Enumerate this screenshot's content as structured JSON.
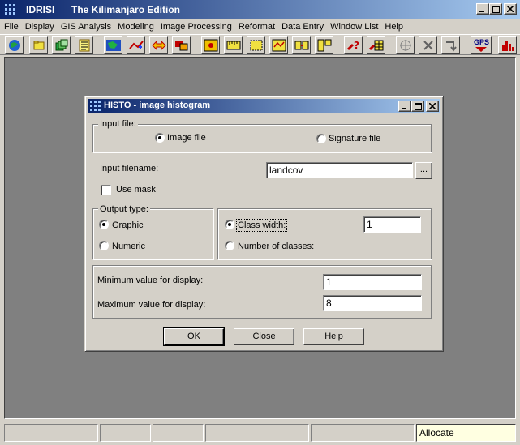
{
  "app": {
    "name": "IDRISI",
    "edition": "The Kilimanjaro Edition"
  },
  "menu": [
    "File",
    "Display",
    "GIS Analysis",
    "Modeling",
    "Image Processing",
    "Reformat",
    "Data Entry",
    "Window List",
    "Help"
  ],
  "toolbar": {
    "gps_label": "GPS"
  },
  "dialog": {
    "title": "HISTO - image histogram",
    "input_file": {
      "group_label": "Input file:",
      "image_file": "Image file",
      "signature_file": "Signature file"
    },
    "input_filename": {
      "label": "Input filename:",
      "value": "landcov",
      "browse": "..."
    },
    "use_mask": "Use mask",
    "output_type": {
      "group_label": "Output type:",
      "graphic": "Graphic",
      "numeric": "Numeric"
    },
    "class": {
      "class_width_label": "Class width:",
      "class_width_value": "1",
      "num_classes_label": "Number of classes:"
    },
    "display": {
      "min_label": "Minimum value for display:",
      "min_value": "1",
      "max_label": "Maximum value for display:",
      "max_value": "8"
    },
    "buttons": {
      "ok": "OK",
      "close": "Close",
      "help": "Help"
    }
  },
  "status": {
    "message": "Allocate"
  }
}
